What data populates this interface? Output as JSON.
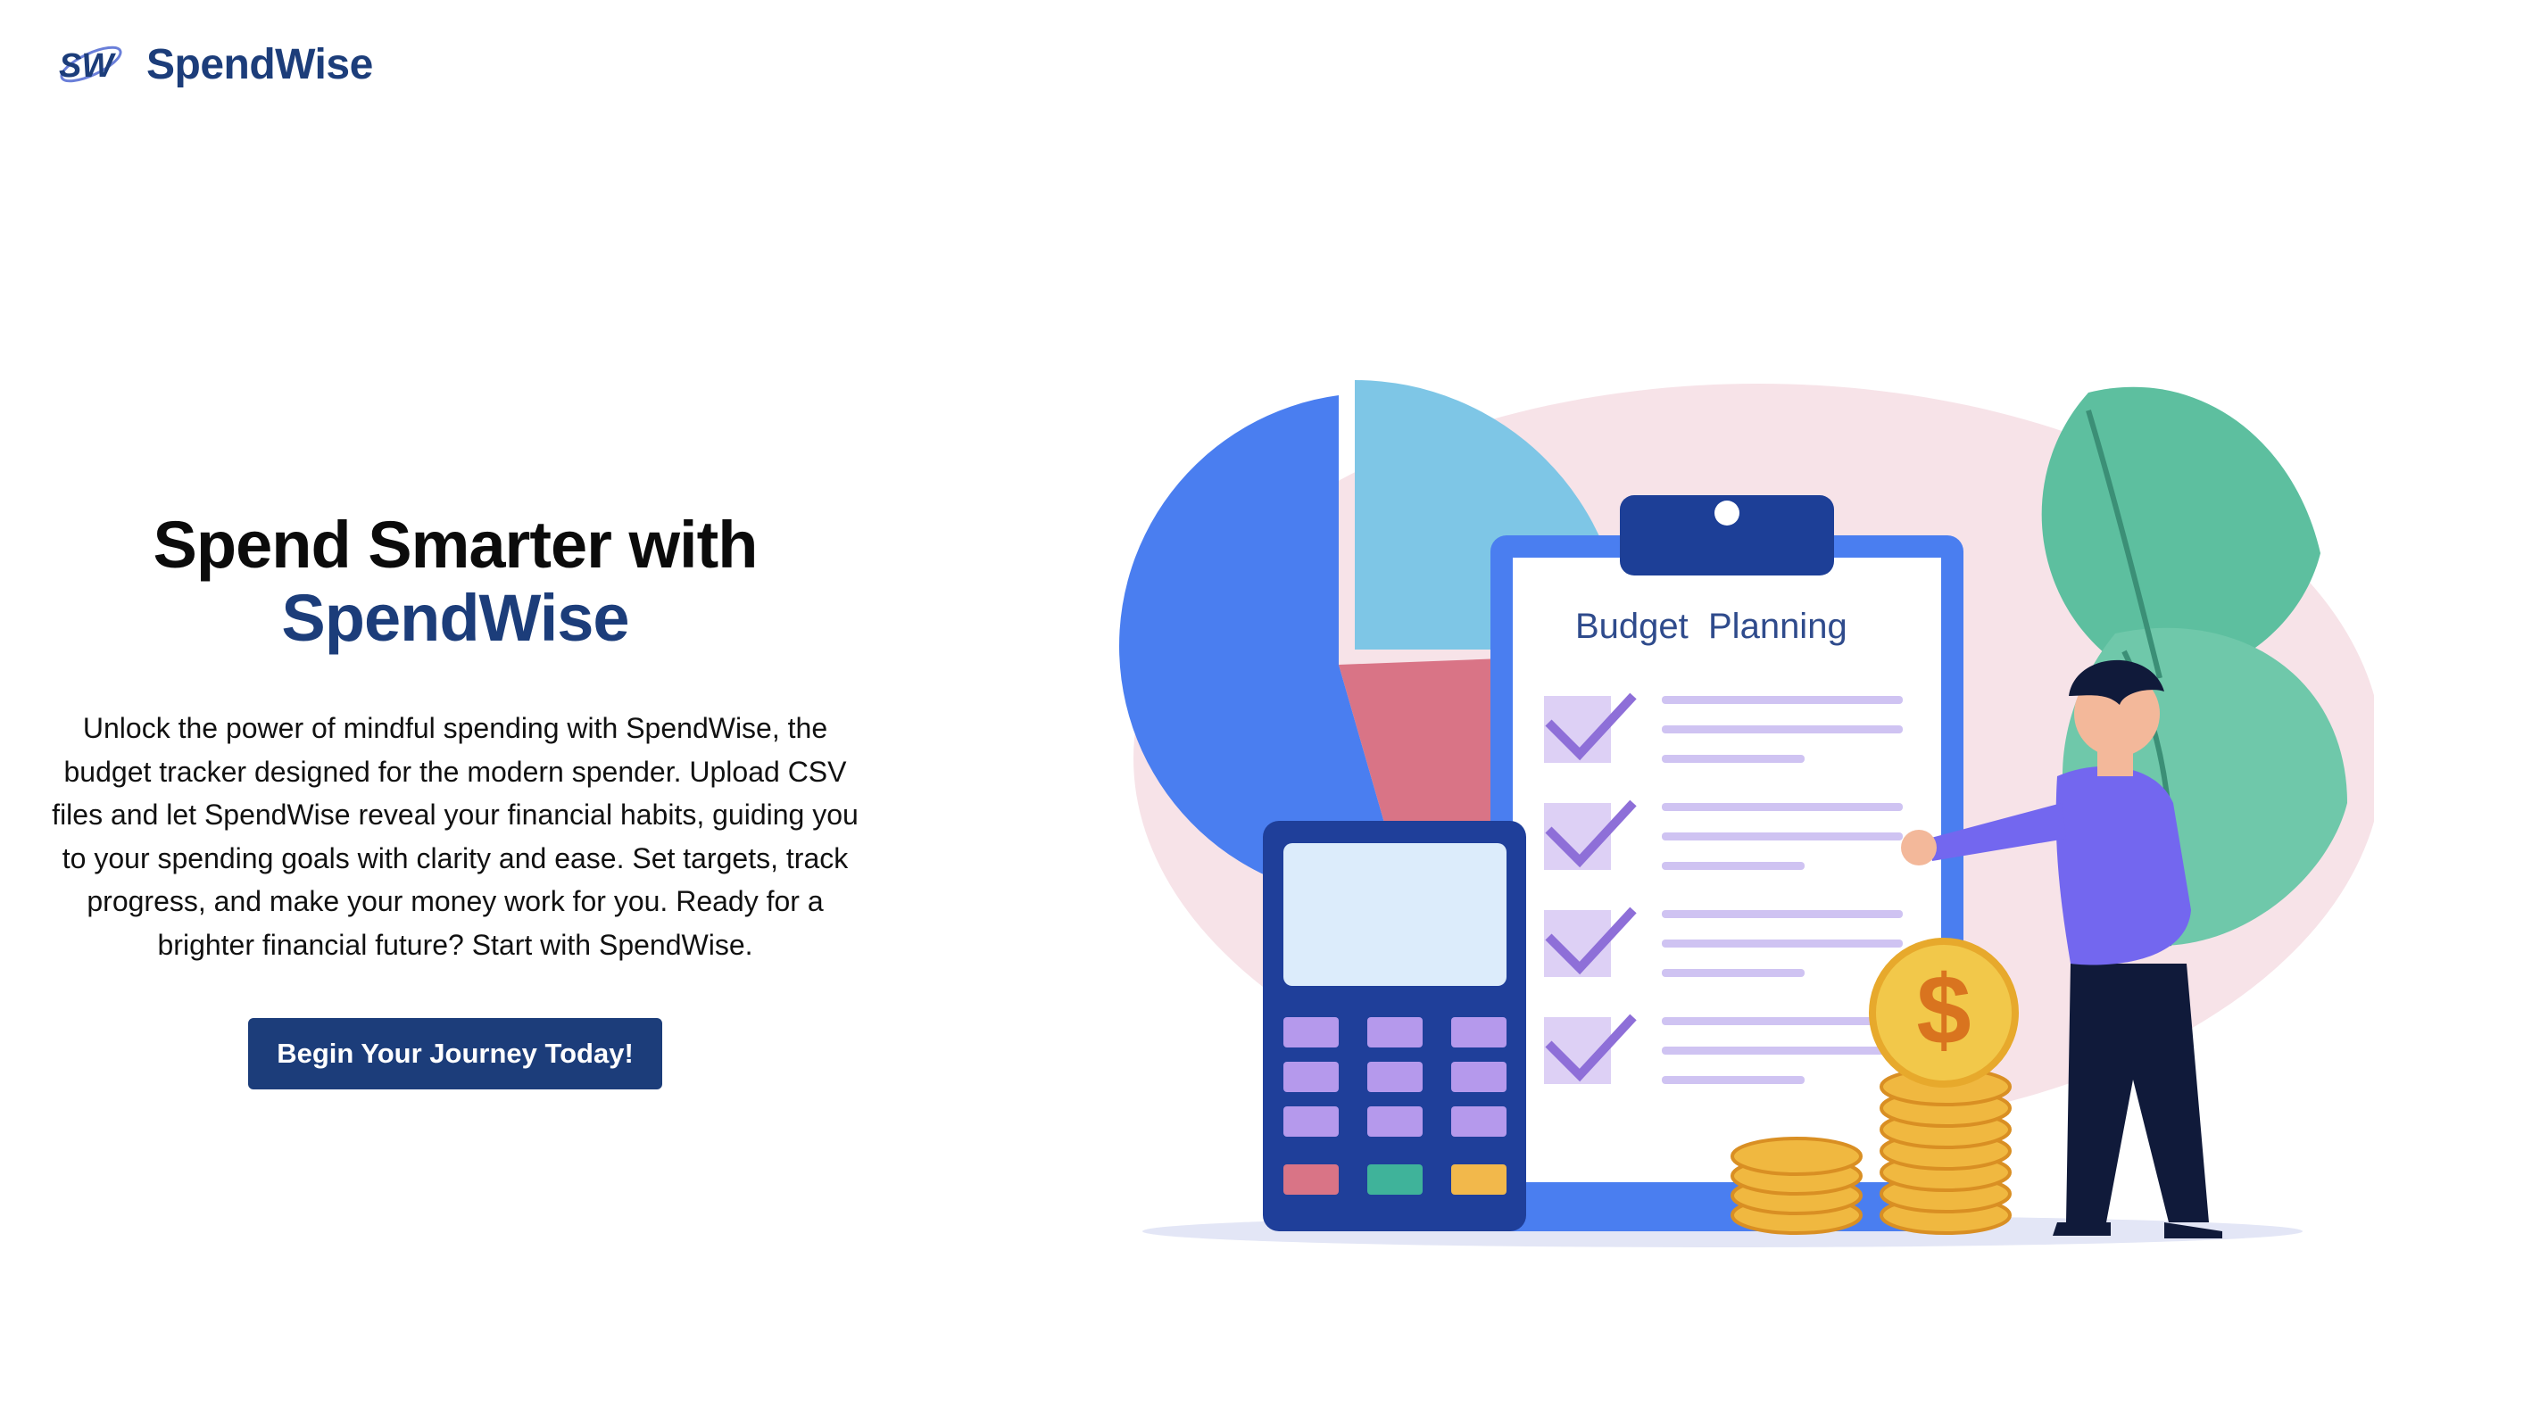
{
  "brand": {
    "logo_text": "SW",
    "name": "SpendWise"
  },
  "hero": {
    "title_line1": "Spend Smarter with",
    "title_line2": "SpendWise",
    "description": "Unlock the power of mindful spending with SpendWise, the budget tracker designed for the modern spender. Upload CSV files and let SpendWise reveal your financial habits, guiding you to your spending goals with clarity and ease. Set targets, track progress, and make your money work for you. Ready for a brighter financial future? Start with SpendWise.",
    "cta_label": "Begin Your Journey Today!"
  },
  "illustration": {
    "clipboard_title": "Budget  Planning",
    "coin_symbol": "$"
  },
  "colors": {
    "brand": "#1c3d7a",
    "text": "#0b0b0b",
    "background": "#ffffff"
  }
}
